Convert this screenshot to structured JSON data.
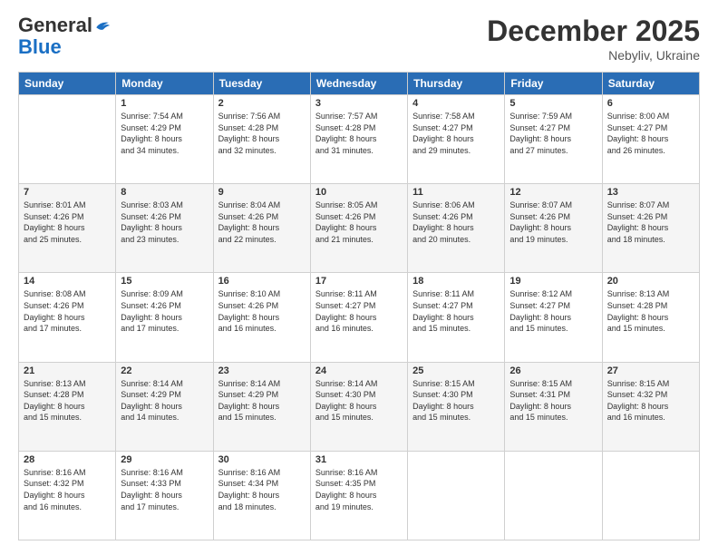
{
  "logo": {
    "line1": "General",
    "line2": "Blue"
  },
  "header": {
    "month_year": "December 2025",
    "location": "Nebyliv, Ukraine"
  },
  "days_of_week": [
    "Sunday",
    "Monday",
    "Tuesday",
    "Wednesday",
    "Thursday",
    "Friday",
    "Saturday"
  ],
  "weeks": [
    [
      {
        "day": "",
        "info": ""
      },
      {
        "day": "1",
        "info": "Sunrise: 7:54 AM\nSunset: 4:29 PM\nDaylight: 8 hours\nand 34 minutes."
      },
      {
        "day": "2",
        "info": "Sunrise: 7:56 AM\nSunset: 4:28 PM\nDaylight: 8 hours\nand 32 minutes."
      },
      {
        "day": "3",
        "info": "Sunrise: 7:57 AM\nSunset: 4:28 PM\nDaylight: 8 hours\nand 31 minutes."
      },
      {
        "day": "4",
        "info": "Sunrise: 7:58 AM\nSunset: 4:27 PM\nDaylight: 8 hours\nand 29 minutes."
      },
      {
        "day": "5",
        "info": "Sunrise: 7:59 AM\nSunset: 4:27 PM\nDaylight: 8 hours\nand 27 minutes."
      },
      {
        "day": "6",
        "info": "Sunrise: 8:00 AM\nSunset: 4:27 PM\nDaylight: 8 hours\nand 26 minutes."
      }
    ],
    [
      {
        "day": "7",
        "info": "Sunrise: 8:01 AM\nSunset: 4:26 PM\nDaylight: 8 hours\nand 25 minutes."
      },
      {
        "day": "8",
        "info": "Sunrise: 8:03 AM\nSunset: 4:26 PM\nDaylight: 8 hours\nand 23 minutes."
      },
      {
        "day": "9",
        "info": "Sunrise: 8:04 AM\nSunset: 4:26 PM\nDaylight: 8 hours\nand 22 minutes."
      },
      {
        "day": "10",
        "info": "Sunrise: 8:05 AM\nSunset: 4:26 PM\nDaylight: 8 hours\nand 21 minutes."
      },
      {
        "day": "11",
        "info": "Sunrise: 8:06 AM\nSunset: 4:26 PM\nDaylight: 8 hours\nand 20 minutes."
      },
      {
        "day": "12",
        "info": "Sunrise: 8:07 AM\nSunset: 4:26 PM\nDaylight: 8 hours\nand 19 minutes."
      },
      {
        "day": "13",
        "info": "Sunrise: 8:07 AM\nSunset: 4:26 PM\nDaylight: 8 hours\nand 18 minutes."
      }
    ],
    [
      {
        "day": "14",
        "info": "Sunrise: 8:08 AM\nSunset: 4:26 PM\nDaylight: 8 hours\nand 17 minutes."
      },
      {
        "day": "15",
        "info": "Sunrise: 8:09 AM\nSunset: 4:26 PM\nDaylight: 8 hours\nand 17 minutes."
      },
      {
        "day": "16",
        "info": "Sunrise: 8:10 AM\nSunset: 4:26 PM\nDaylight: 8 hours\nand 16 minutes."
      },
      {
        "day": "17",
        "info": "Sunrise: 8:11 AM\nSunset: 4:27 PM\nDaylight: 8 hours\nand 16 minutes."
      },
      {
        "day": "18",
        "info": "Sunrise: 8:11 AM\nSunset: 4:27 PM\nDaylight: 8 hours\nand 15 minutes."
      },
      {
        "day": "19",
        "info": "Sunrise: 8:12 AM\nSunset: 4:27 PM\nDaylight: 8 hours\nand 15 minutes."
      },
      {
        "day": "20",
        "info": "Sunrise: 8:13 AM\nSunset: 4:28 PM\nDaylight: 8 hours\nand 15 minutes."
      }
    ],
    [
      {
        "day": "21",
        "info": "Sunrise: 8:13 AM\nSunset: 4:28 PM\nDaylight: 8 hours\nand 15 minutes."
      },
      {
        "day": "22",
        "info": "Sunrise: 8:14 AM\nSunset: 4:29 PM\nDaylight: 8 hours\nand 14 minutes."
      },
      {
        "day": "23",
        "info": "Sunrise: 8:14 AM\nSunset: 4:29 PM\nDaylight: 8 hours\nand 15 minutes."
      },
      {
        "day": "24",
        "info": "Sunrise: 8:14 AM\nSunset: 4:30 PM\nDaylight: 8 hours\nand 15 minutes."
      },
      {
        "day": "25",
        "info": "Sunrise: 8:15 AM\nSunset: 4:30 PM\nDaylight: 8 hours\nand 15 minutes."
      },
      {
        "day": "26",
        "info": "Sunrise: 8:15 AM\nSunset: 4:31 PM\nDaylight: 8 hours\nand 15 minutes."
      },
      {
        "day": "27",
        "info": "Sunrise: 8:15 AM\nSunset: 4:32 PM\nDaylight: 8 hours\nand 16 minutes."
      }
    ],
    [
      {
        "day": "28",
        "info": "Sunrise: 8:16 AM\nSunset: 4:32 PM\nDaylight: 8 hours\nand 16 minutes."
      },
      {
        "day": "29",
        "info": "Sunrise: 8:16 AM\nSunset: 4:33 PM\nDaylight: 8 hours\nand 17 minutes."
      },
      {
        "day": "30",
        "info": "Sunrise: 8:16 AM\nSunset: 4:34 PM\nDaylight: 8 hours\nand 18 minutes."
      },
      {
        "day": "31",
        "info": "Sunrise: 8:16 AM\nSunset: 4:35 PM\nDaylight: 8 hours\nand 19 minutes."
      },
      {
        "day": "",
        "info": ""
      },
      {
        "day": "",
        "info": ""
      },
      {
        "day": "",
        "info": ""
      }
    ]
  ]
}
